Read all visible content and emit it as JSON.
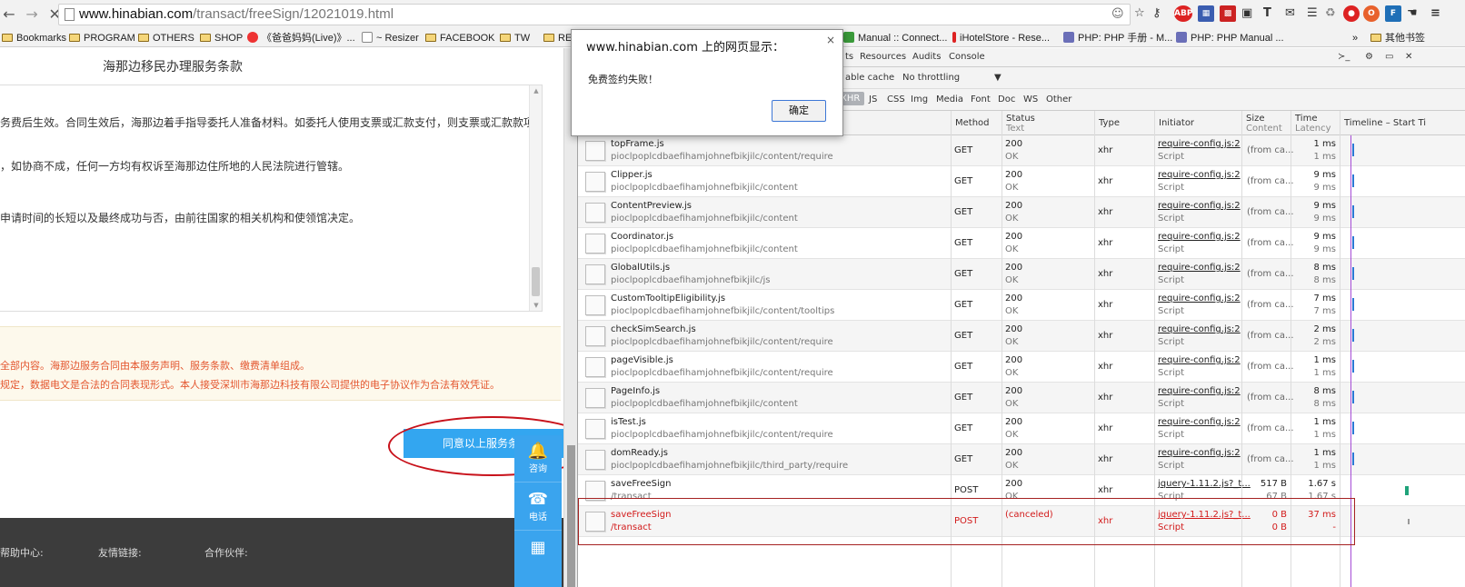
{
  "browser": {
    "url_domain": "www.hinabian.com",
    "url_path": "/transact/freeSign/12021019.html",
    "bookmarks": [
      "Bookmarks",
      "PROGRAM",
      "OTHERS",
      "SHOP",
      "《爸爸妈妈(Live)》...",
      "~ Resizer",
      "FACEBOOK",
      "TW",
      "REA",
      "Manual :: Connect...",
      "iHotelStore - Rese...",
      "PHP: PHP 手册 - M...",
      "PHP: PHP Manual ...",
      "»",
      "其他书签"
    ],
    "ext_abp": "ABP"
  },
  "page": {
    "title": "海那边移民办理服务条款",
    "terms": [
      "务费后生效。合同生效后，海那边着手指导委托人准备材料。如委托人使用支票或汇款支付，则支票或汇款款项",
      "，如协商不成，任何一方均有权诉至海那边住所地的人民法院进行管辖。",
      "申请时间的长短以及最终成功与否，由前往国家的相关机构和使领馆决定。"
    ],
    "notice": [
      "全部内容。海那边服务合同由本服务声明、服务条款、缴费清单组成。",
      "规定，数据电文是合法的合同表现形式。本人接受深圳市海那边科技有限公司提供的电子协议作为合法有效凭证。"
    ],
    "agree_button": "同意以上服务条款，",
    "side_widget": {
      "consult": "咨询",
      "phone": "电话"
    },
    "footer": [
      "帮助中心:",
      "友情链接:",
      "合作伙伴:"
    ]
  },
  "devtools": {
    "tabs": [
      "ts",
      "Resources",
      "Audits",
      "Console"
    ],
    "disable_cache": "able cache",
    "throttle": "No throttling",
    "filters": [
      "XHR",
      "JS",
      "CSS",
      "Img",
      "Media",
      "Font",
      "Doc",
      "WS",
      "Other"
    ],
    "columns": {
      "method": "Method",
      "status": "Status",
      "status_sub": "Text",
      "type": "Type",
      "initiator": "Initiator",
      "size": "Size",
      "size_sub": "Content",
      "time": "Time",
      "time_sub": "Latency",
      "timeline": "Timeline – Start Ti"
    },
    "rows": [
      {
        "name": "topFrame.js",
        "path": "pioclpoplcdbaefihamjohnefbikjilc/content/require",
        "method": "GET",
        "status": "200",
        "status_text": "OK",
        "type": "xhr",
        "initiator": "require-config.js:2",
        "initiator_type": "Script",
        "size": "(from ca...",
        "size2": "",
        "time": "1 ms",
        "latency": "1 ms"
      },
      {
        "name": "Clipper.js",
        "path": "pioclpoplcdbaefihamjohnefbikjilc/content",
        "method": "GET",
        "status": "200",
        "status_text": "OK",
        "type": "xhr",
        "initiator": "require-config.js:2",
        "initiator_type": "Script",
        "size": "(from ca...",
        "size2": "",
        "time": "9 ms",
        "latency": "9 ms"
      },
      {
        "name": "ContentPreview.js",
        "path": "pioclpoplcdbaefihamjohnefbikjilc/content",
        "method": "GET",
        "status": "200",
        "status_text": "OK",
        "type": "xhr",
        "initiator": "require-config.js:2",
        "initiator_type": "Script",
        "size": "(from ca...",
        "size2": "",
        "time": "9 ms",
        "latency": "9 ms"
      },
      {
        "name": "Coordinator.js",
        "path": "pioclpoplcdbaefihamjohnefbikjilc/content",
        "method": "GET",
        "status": "200",
        "status_text": "OK",
        "type": "xhr",
        "initiator": "require-config.js:2",
        "initiator_type": "Script",
        "size": "(from ca...",
        "size2": "",
        "time": "9 ms",
        "latency": "9 ms"
      },
      {
        "name": "GlobalUtils.js",
        "path": "pioclpoplcdbaefihamjohnefbikjilc/js",
        "method": "GET",
        "status": "200",
        "status_text": "OK",
        "type": "xhr",
        "initiator": "require-config.js:2",
        "initiator_type": "Script",
        "size": "(from ca...",
        "size2": "",
        "time": "8 ms",
        "latency": "8 ms"
      },
      {
        "name": "CustomTooltipEligibility.js",
        "path": "pioclpoplcdbaefihamjohnefbikjilc/content/tooltips",
        "method": "GET",
        "status": "200",
        "status_text": "OK",
        "type": "xhr",
        "initiator": "require-config.js:2",
        "initiator_type": "Script",
        "size": "(from ca...",
        "size2": "",
        "time": "7 ms",
        "latency": "7 ms"
      },
      {
        "name": "checkSimSearch.js",
        "path": "pioclpoplcdbaefihamjohnefbikjilc/content/require",
        "method": "GET",
        "status": "200",
        "status_text": "OK",
        "type": "xhr",
        "initiator": "require-config.js:2",
        "initiator_type": "Script",
        "size": "(from ca...",
        "size2": "",
        "time": "2 ms",
        "latency": "2 ms"
      },
      {
        "name": "pageVisible.js",
        "path": "pioclpoplcdbaefihamjohnefbikjilc/content/require",
        "method": "GET",
        "status": "200",
        "status_text": "OK",
        "type": "xhr",
        "initiator": "require-config.js:2",
        "initiator_type": "Script",
        "size": "(from ca...",
        "size2": "",
        "time": "1 ms",
        "latency": "1 ms"
      },
      {
        "name": "PageInfo.js",
        "path": "pioclpoplcdbaefihamjohnefbikjilc/content",
        "method": "GET",
        "status": "200",
        "status_text": "OK",
        "type": "xhr",
        "initiator": "require-config.js:2",
        "initiator_type": "Script",
        "size": "(from ca...",
        "size2": "",
        "time": "8 ms",
        "latency": "8 ms"
      },
      {
        "name": "isTest.js",
        "path": "pioclpoplcdbaefihamjohnefbikjilc/content/require",
        "method": "GET",
        "status": "200",
        "status_text": "OK",
        "type": "xhr",
        "initiator": "require-config.js:2",
        "initiator_type": "Script",
        "size": "(from ca...",
        "size2": "",
        "time": "1 ms",
        "latency": "1 ms"
      },
      {
        "name": "domReady.js",
        "path": "pioclpoplcdbaefihamjohnefbikjilc/third_party/require",
        "method": "GET",
        "status": "200",
        "status_text": "OK",
        "type": "xhr",
        "initiator": "require-config.js:2",
        "initiator_type": "Script",
        "size": "(from ca...",
        "size2": "",
        "time": "1 ms",
        "latency": "1 ms"
      },
      {
        "name": "saveFreeSign",
        "path": "/transact",
        "method": "POST",
        "status": "200",
        "status_text": "OK",
        "type": "xhr",
        "initiator": "jquery-1.11.2.js?_t...",
        "initiator_type": "Script",
        "size": "517 B",
        "size2": "67 B",
        "time": "1.67 s",
        "latency": "1.67 s"
      },
      {
        "name": "saveFreeSign",
        "path": "/transact",
        "method": "POST",
        "status": "(canceled)",
        "status_text": "",
        "type": "xhr",
        "initiator": "jquery-1.11.2.js?_t...",
        "initiator_type": "Script",
        "size": "0 B",
        "size2": "0 B",
        "time": "37 ms",
        "latency": "-"
      }
    ]
  },
  "dialog": {
    "title": "www.hinabian.com 上的网页显示：",
    "close": "×",
    "message": "免费签约失败！",
    "ok": "确定"
  }
}
